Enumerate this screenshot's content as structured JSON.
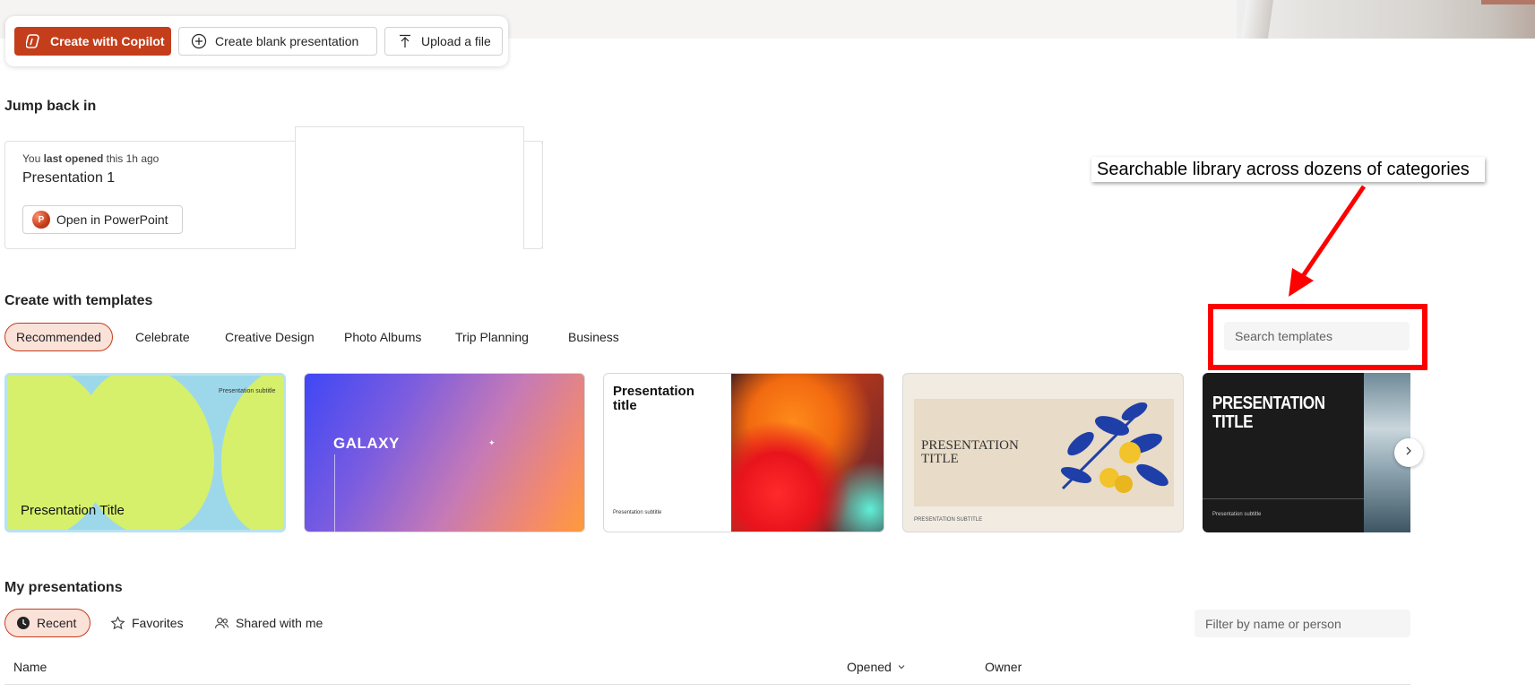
{
  "actions": {
    "copilot_label": "Create with Copilot",
    "blank_label": "Create blank presentation",
    "upload_label": "Upload a file"
  },
  "jump_back": {
    "title": "Jump back in",
    "meta_prefix": "You",
    "meta_bold": "last opened",
    "meta_suffix": "this 1h ago",
    "file_name": "Presentation 1",
    "open_label": "Open in PowerPoint",
    "app_letter": "P"
  },
  "callout": {
    "text": "Searchable library across dozens of categories",
    "highlight_color": "#ff0000"
  },
  "templates": {
    "title": "Create with templates",
    "categories": [
      "Recommended",
      "Celebrate",
      "Creative Design",
      "Photo Albums",
      "Trip Planning",
      "Business"
    ],
    "active_category": "Recommended",
    "search_placeholder": "Search templates",
    "cards": [
      {
        "title": "Presentation Title",
        "subtitle": "Presentation subtitle"
      },
      {
        "title": "GALAXY"
      },
      {
        "title_line1": "Presentation",
        "title_line2": "title",
        "subtitle": "Presentation subtitle"
      },
      {
        "title_line1": "PRESENTATION",
        "title_line2": "TITLE",
        "subtitle": "PRESENTATION SUBTITLE"
      },
      {
        "title_line1": "PRESENTATION",
        "title_line2": "TITLE",
        "subtitle": "Presentation subtitle"
      }
    ]
  },
  "my_presentations": {
    "title": "My presentations",
    "tabs": [
      "Recent",
      "Favorites",
      "Shared with me"
    ],
    "active_tab": "Recent",
    "filter_placeholder": "Filter by name or person",
    "columns": {
      "name": "Name",
      "opened": "Opened",
      "owner": "Owner"
    }
  },
  "colors": {
    "accent": "#c43e1c",
    "active_pill_bg": "#fbe2d9"
  },
  "icons": [
    "copilot-icon",
    "plus-circle-icon",
    "upload-icon",
    "powerpoint-icon",
    "chevron-right-icon",
    "clock-icon",
    "star-icon",
    "people-icon",
    "chevron-down-icon"
  ]
}
